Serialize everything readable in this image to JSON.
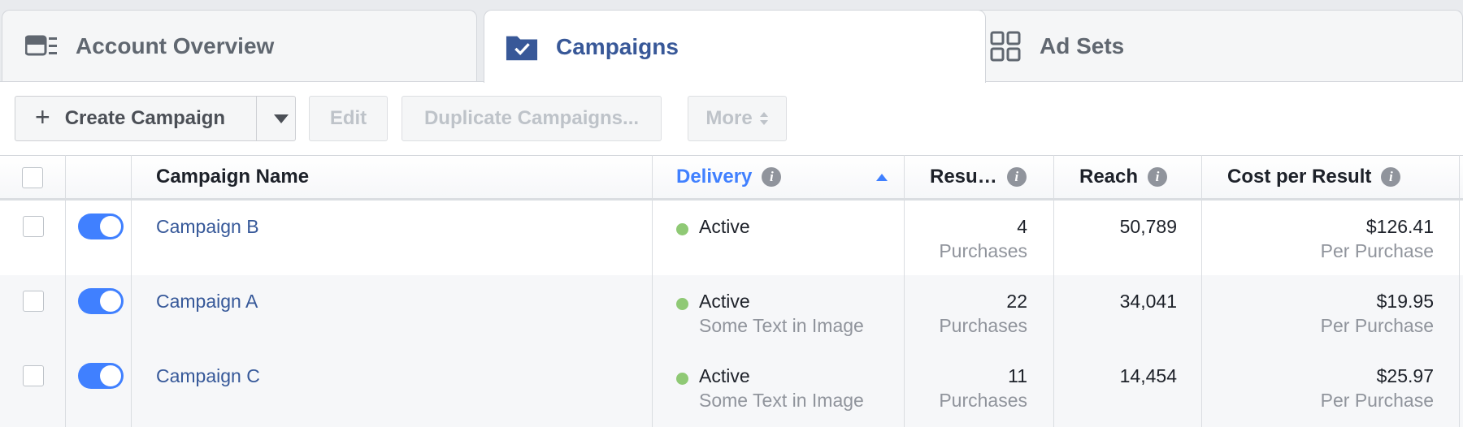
{
  "tabs": [
    {
      "label": "Account Overview",
      "icon": "account-overview-icon",
      "active": false
    },
    {
      "label": "Campaigns",
      "icon": "campaign-folder-icon",
      "active": true
    },
    {
      "label": "Ad Sets",
      "icon": "ad-sets-grid-icon",
      "active": false
    }
  ],
  "toolbar": {
    "create_label": "Create Campaign",
    "edit_label": "Edit",
    "duplicate_label": "Duplicate Campaigns...",
    "more_label": "More"
  },
  "table": {
    "headers": {
      "name": "Campaign Name",
      "delivery": "Delivery",
      "results": "Resu…",
      "reach": "Reach",
      "cost": "Cost per Result"
    },
    "sort_column": "Delivery",
    "sort_direction": "ascending",
    "rows": [
      {
        "name": "Campaign B",
        "on": true,
        "delivery": "Active",
        "delivery_note": "",
        "results": "4",
        "results_unit": "Purchases",
        "reach": "50,789",
        "cost": "$126.41",
        "cost_unit": "Per Purchase"
      },
      {
        "name": "Campaign A",
        "on": true,
        "delivery": "Active",
        "delivery_note": "Some Text in Image",
        "results": "22",
        "results_unit": "Purchases",
        "reach": "34,041",
        "cost": "$19.95",
        "cost_unit": "Per Purchase"
      },
      {
        "name": "Campaign C",
        "on": true,
        "delivery": "Active",
        "delivery_note": "Some Text in Image",
        "results": "11",
        "results_unit": "Purchases",
        "reach": "14,454",
        "cost": "$25.97",
        "cost_unit": "Per Purchase"
      }
    ]
  },
  "colors": {
    "brand_blue": "#385898",
    "link_blue": "#365899",
    "accent_blue": "#4080ff",
    "active_green": "#8fc975",
    "muted_text": "#90949c"
  }
}
